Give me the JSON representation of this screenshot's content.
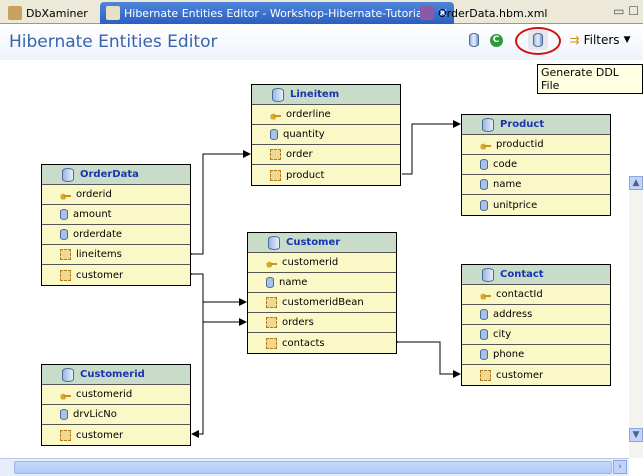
{
  "tabs": [
    {
      "label": "DbXaminer",
      "active": false
    },
    {
      "label": "Hibernate Entities Editor - Workshop-Hibernate-Tutorial",
      "active": true
    },
    {
      "label": "OrderData.hbm.xml",
      "active": false
    }
  ],
  "header": {
    "title": "Hibernate Entities Editor",
    "filters_label": "Filters",
    "tooltip": "Generate DDL File"
  },
  "entities": {
    "orderdata": {
      "name": "OrderData",
      "fields": [
        {
          "name": "orderid",
          "type": "key"
        },
        {
          "name": "amount",
          "type": "col"
        },
        {
          "name": "orderdate",
          "type": "col"
        },
        {
          "name": "lineitems",
          "type": "many"
        },
        {
          "name": "customer",
          "type": "one"
        }
      ]
    },
    "lineitem": {
      "name": "Lineitem",
      "fields": [
        {
          "name": "orderline",
          "type": "key"
        },
        {
          "name": "quantity",
          "type": "col"
        },
        {
          "name": "order",
          "type": "one"
        },
        {
          "name": "product",
          "type": "one"
        }
      ]
    },
    "product": {
      "name": "Product",
      "fields": [
        {
          "name": "productid",
          "type": "key"
        },
        {
          "name": "code",
          "type": "col"
        },
        {
          "name": "name",
          "type": "col"
        },
        {
          "name": "unitprice",
          "type": "col"
        }
      ]
    },
    "customer": {
      "name": "Customer",
      "fields": [
        {
          "name": "customerid",
          "type": "key"
        },
        {
          "name": "name",
          "type": "col"
        },
        {
          "name": "customeridBean",
          "type": "one"
        },
        {
          "name": "orders",
          "type": "many"
        },
        {
          "name": "contacts",
          "type": "many"
        }
      ]
    },
    "contact": {
      "name": "Contact",
      "fields": [
        {
          "name": "contactId",
          "type": "key"
        },
        {
          "name": "address",
          "type": "col"
        },
        {
          "name": "city",
          "type": "col"
        },
        {
          "name": "phone",
          "type": "col"
        },
        {
          "name": "customer",
          "type": "one"
        }
      ]
    },
    "customerid": {
      "name": "Customerid",
      "fields": [
        {
          "name": "customerid",
          "type": "key"
        },
        {
          "name": "drvLicNo",
          "type": "col"
        },
        {
          "name": "customer",
          "type": "one"
        }
      ]
    }
  }
}
